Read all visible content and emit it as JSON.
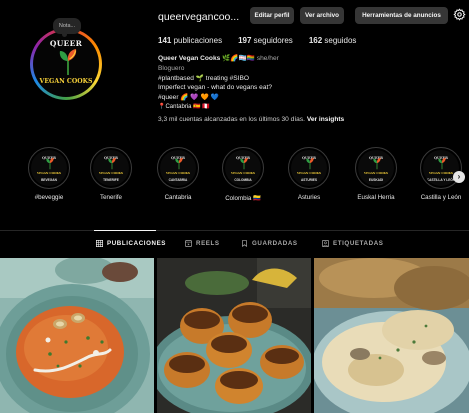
{
  "profile": {
    "username": "queervegancoo...",
    "note": "Nota...",
    "avatar_text_top": "QUEER",
    "avatar_text_bottom": "VEGAN COOKS"
  },
  "buttons": {
    "edit": "Editar perfil",
    "archive": "Ver archivo",
    "tools": "Herramientas de anuncios"
  },
  "stats": {
    "posts_count": "141",
    "posts_label": "publicaciones",
    "followers_count": "197",
    "followers_label": "seguidores",
    "following_count": "162",
    "following_label": "seguidos"
  },
  "bio": {
    "name": "Queer Vegan Cooks",
    "name_emojis": "🌿🌈🏳️‍⚧️🏳️‍🌈",
    "pronouns": "she/her",
    "category": "Bloguero",
    "line1": "#plantbased 🌱 treating #SIBO",
    "line2": "Imperfect vegan - what do vegans eat?",
    "line3": "#queer 🌈 💜 🧡 💙",
    "line4": "📍Cantabria 🇪🇸 🇵🇪"
  },
  "insights": {
    "text": "3,3 mil cuentas alcanzadas en los últimos 30 días.",
    "link": "Ver insights"
  },
  "highlights": [
    {
      "label": "#beveggie",
      "cover": "bevegan"
    },
    {
      "label": "Tenerife",
      "cover": "tenerife"
    },
    {
      "label": "Cantabria",
      "cover": "cantabria"
    },
    {
      "label": "Colombia 🇨🇴",
      "cover": "colombia"
    },
    {
      "label": "Asturies",
      "cover": "asturies"
    },
    {
      "label": "Euskal Herria",
      "cover": "euskadi"
    },
    {
      "label": "Castilla y León",
      "cover": "castilla y león"
    }
  ],
  "highlight_cover_top": "QUEER",
  "highlight_cover_bottom": "VEGAN COOKS",
  "tabs": {
    "posts": "PUBLICACIONES",
    "reels": "REELS",
    "saved": "GUARDADAS",
    "tagged": "ETIQUETADAS"
  },
  "icons": {
    "settings": "gear-icon",
    "next": "chevron-right-icon",
    "posts_tab": "grid-icon",
    "reels_tab": "reels-icon",
    "saved_tab": "bookmark-icon",
    "tagged_tab": "tag-icon"
  },
  "colors": {
    "background": "#000000",
    "button": "#363636",
    "accent_yellow": "#f9d33a",
    "muted_text": "#a8a8a8"
  }
}
